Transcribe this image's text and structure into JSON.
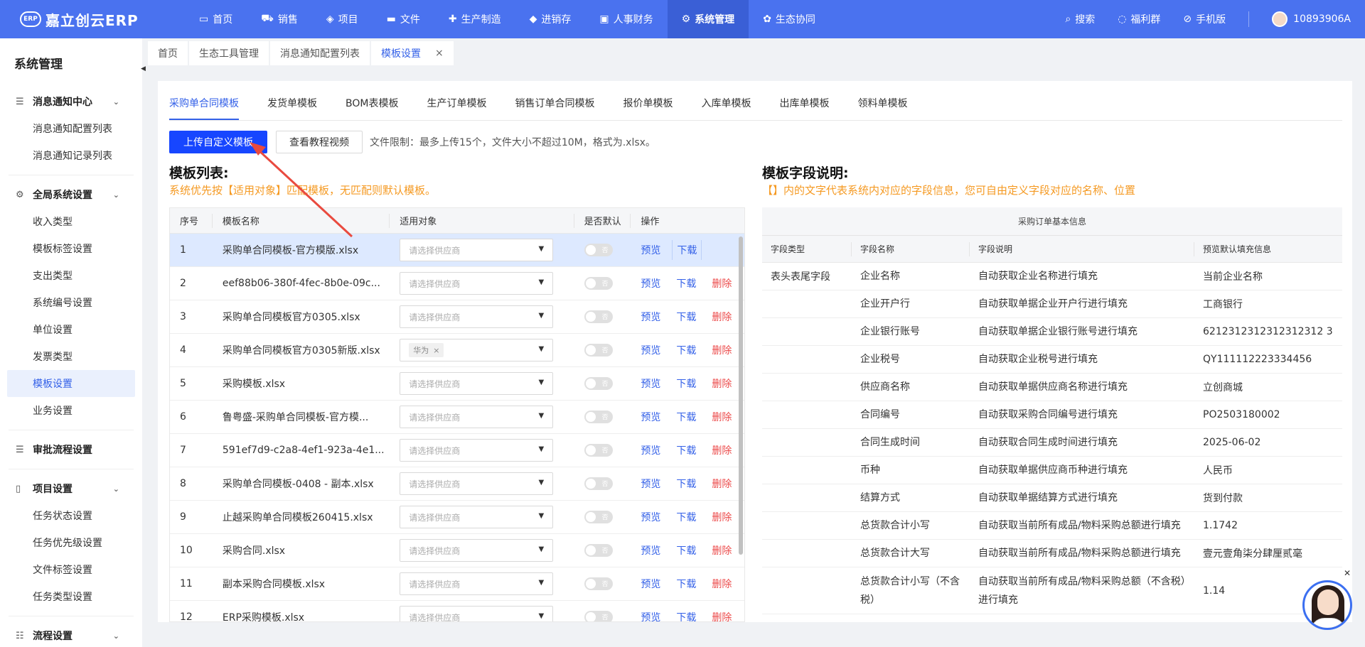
{
  "topbar": {
    "logo_text": "嘉立创云ERP",
    "logo_badge": "ERP",
    "nav": [
      {
        "label": "首页",
        "icon": "monitor-icon"
      },
      {
        "label": "销售",
        "icon": "cart-icon"
      },
      {
        "label": "项目",
        "icon": "layers-icon"
      },
      {
        "label": "文件",
        "icon": "folder-icon"
      },
      {
        "label": "生产制造",
        "icon": "puzzle-icon"
      },
      {
        "label": "进销存",
        "icon": "cube-icon"
      },
      {
        "label": "人事财务",
        "icon": "book-icon"
      },
      {
        "label": "系统管理",
        "icon": "gear-icon"
      },
      {
        "label": "生态协同",
        "icon": "cluster-icon"
      }
    ],
    "search": "搜索",
    "welfare": "福利群",
    "mobile": "手机版",
    "user": "10893906A"
  },
  "sidebar": {
    "title": "系统管理",
    "groups": [
      {
        "label": "消息通知中心",
        "items": [
          "消息通知配置列表",
          "消息通知记录列表"
        ]
      },
      {
        "label": "全局系统设置",
        "items": [
          "收入类型",
          "模板标签设置",
          "支出类型",
          "系统编号设置",
          "单位设置",
          "发票类型",
          "模板设置",
          "业务设置"
        ]
      },
      {
        "label": "审批流程设置",
        "items": []
      },
      {
        "label": "项目设置",
        "items": [
          "任务状态设置",
          "任务优先级设置",
          "文件标签设置",
          "任务类型设置"
        ]
      },
      {
        "label": "流程设置",
        "items": []
      }
    ]
  },
  "tabs": [
    "首页",
    "生态工具管理",
    "消息通知配置列表",
    "模板设置"
  ],
  "subtabs": [
    "采购单合同模板",
    "发货单模板",
    "BOM表模板",
    "生产订单模板",
    "销售订单合同模板",
    "报价单模板",
    "入库单模板",
    "出库单模板",
    "领料单模板"
  ],
  "toolbar": {
    "upload": "上传自定义模板",
    "video": "查看教程视频",
    "limit": "文件限制：最多上传15个，文件大小不超过10M，格式为.xlsx。"
  },
  "left": {
    "title": "模板列表:",
    "hint": "系统优先按【适用对象】匹配模板，无匹配则默认模板。",
    "headers": {
      "no": "序号",
      "name": "模板名称",
      "obj": "适用对象",
      "def": "是否默认",
      "op": "操作"
    },
    "placeholder": "请选择供应商",
    "switch_text": "否",
    "preview": "预览",
    "download": "下载",
    "delete": "删除",
    "rows": [
      {
        "no": "1",
        "name": "采购单合同模板-官方模版.xlsx",
        "tag": ""
      },
      {
        "no": "2",
        "name": "eef88b06-380f-4fec-8b0e-09c...",
        "tag": ""
      },
      {
        "no": "3",
        "name": "采购单合同模板官方0305.xlsx",
        "tag": ""
      },
      {
        "no": "4",
        "name": "采购单合同模板官方0305新版.xlsx",
        "tag": "华为"
      },
      {
        "no": "5",
        "name": "采购模板.xlsx",
        "tag": ""
      },
      {
        "no": "6",
        "name": "鲁粤盛-采购单合同模板-官方模...",
        "tag": ""
      },
      {
        "no": "7",
        "name": "591ef7d9-c2a8-4ef1-923a-4e1...",
        "tag": ""
      },
      {
        "no": "8",
        "name": "采购单合同模板-0408 - 副本.xlsx",
        "tag": ""
      },
      {
        "no": "9",
        "name": "止越采购单合同模板260415.xlsx",
        "tag": ""
      },
      {
        "no": "10",
        "name": "采购合同.xlsx",
        "tag": ""
      },
      {
        "no": "11",
        "name": "副本采购合同模板.xlsx",
        "tag": ""
      },
      {
        "no": "12",
        "name": "ERP采购模板.xlsx",
        "tag": ""
      }
    ]
  },
  "right": {
    "title": "模板字段说明:",
    "hint": "【】内的文字代表系统内对应的字段信息，您可自由定义字段对应的名称、位置",
    "caption": "采购订单基本信息",
    "headers": {
      "type": "字段类型",
      "name": "字段名称",
      "desc": "字段说明",
      "def": "预览默认填充信息"
    },
    "rows": [
      {
        "type": "表头表尾字段",
        "name": "企业名称",
        "desc": "自动获取企业名称进行填充",
        "def": "当前企业名称"
      },
      {
        "type": "",
        "name": "企业开户行",
        "desc": "自动获取单据企业开户行进行填充",
        "def": "工商银行"
      },
      {
        "type": "",
        "name": "企业银行账号",
        "desc": "自动获取单据企业银行账号进行填充",
        "def": "6212312312312312312 3"
      },
      {
        "type": "",
        "name": "企业税号",
        "desc": "自动获取企业税号进行填充",
        "def": "QY111112223334456"
      },
      {
        "type": "",
        "name": "供应商名称",
        "desc": "自动获取单据供应商名称进行填充",
        "def": "立创商城"
      },
      {
        "type": "",
        "name": "合同编号",
        "desc": "自动获取采购合同编号进行填充",
        "def": "PO2503180002"
      },
      {
        "type": "",
        "name": "合同生成时间",
        "desc": "自动获取合同生成时间进行填充",
        "def": "2025-06-02"
      },
      {
        "type": "",
        "name": "币种",
        "desc": "自动获取单据供应商币种进行填充",
        "def": "人民币"
      },
      {
        "type": "",
        "name": "结算方式",
        "desc": "自动获取单据结算方式进行填充",
        "def": "货到付款"
      },
      {
        "type": "",
        "name": "总货款合计小写",
        "desc": "自动获取当前所有成品/物料采购总额进行填充",
        "def": "1.1742"
      },
      {
        "type": "",
        "name": "总货款合计大写",
        "desc": "自动获取当前所有成品/物料采购总额进行填充",
        "def": "壹元壹角柒分肆厘贰毫"
      },
      {
        "type": "",
        "name": "总货款合计小写（不含税）",
        "desc": "自动获取当前所有成品/物料采购总额（不含税）进行填充",
        "def": "1.14"
      }
    ]
  },
  "colors": {
    "brand": "#4a72ef",
    "primary_button": "#1746ff",
    "hint": "#f59a23",
    "link": "#3461e8",
    "danger": "#ec4c4c",
    "arrow": "#e94a3f"
  }
}
